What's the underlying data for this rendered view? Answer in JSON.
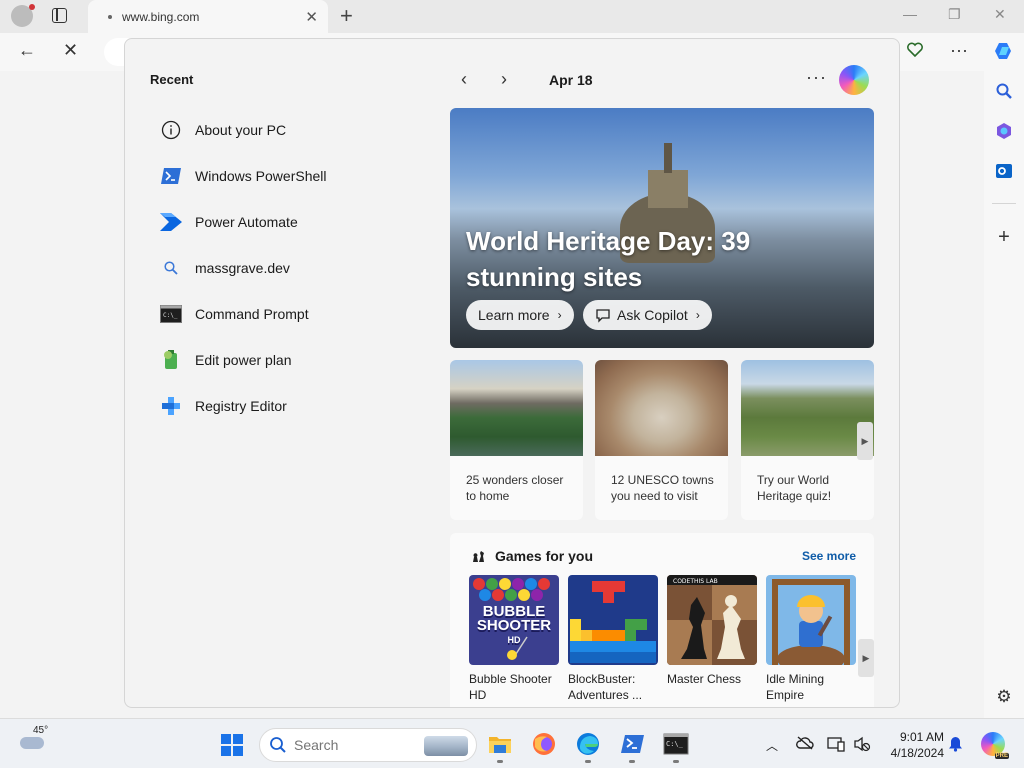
{
  "browser": {
    "tab_title": "www.bing.com",
    "tab_close_glyph": "✕",
    "new_tab_glyph": "+",
    "window_minimize_glyph": "—",
    "window_restore_glyph": "❐",
    "window_close_glyph": "✕",
    "back_glyph": "←",
    "stop_glyph": "✕",
    "more_glyph": "···",
    "add_glyph": "+",
    "settings_glyph": "⚙"
  },
  "start_panel": {
    "recent_title": "Recent",
    "recent_items": [
      {
        "label": "About your PC",
        "icon": "info-icon"
      },
      {
        "label": "Windows PowerShell",
        "icon": "powershell-icon"
      },
      {
        "label": "Power Automate",
        "icon": "power-automate-icon"
      },
      {
        "label": "massgrave.dev",
        "icon": "search-icon"
      },
      {
        "label": "Command Prompt",
        "icon": "command-prompt-icon"
      },
      {
        "label": "Edit power plan",
        "icon": "power-plan-icon"
      },
      {
        "label": "Registry Editor",
        "icon": "registry-editor-icon"
      }
    ],
    "prev_glyph": "‹",
    "next_glyph": "›",
    "date": "Apr 18",
    "more_glyph": "···",
    "hero": {
      "title": "World Heritage Day: 39 stunning sites",
      "learn_more": "Learn more",
      "ask_copilot": "Ask Copilot",
      "chevron": "›"
    },
    "cards": [
      {
        "caption": "25 wonders closer to home"
      },
      {
        "caption": "12 UNESCO towns you need to visit"
      },
      {
        "caption": "Try our World Heritage quiz!"
      }
    ],
    "scroll_glyph": "▶",
    "games": {
      "title": "Games for you",
      "see_more": "See more",
      "bubble_logo": "BUBBLE SHOOTER",
      "bubble_logo_sub": "HD",
      "chess_logo": "CODETHIS LAB",
      "items": [
        {
          "name": "Bubble Shooter HD"
        },
        {
          "name": "BlockBuster: Adventures ..."
        },
        {
          "name": "Master Chess"
        },
        {
          "name": "Idle Mining Empire"
        }
      ]
    }
  },
  "taskbar": {
    "weather_temp": "45°",
    "search_placeholder": "Search",
    "time": "9:01 AM",
    "date": "4/18/2024",
    "copilot_badge": "PRE",
    "chevron_glyph": "︿"
  },
  "colors": {
    "accent": "#0f5ca8",
    "windows_blue": "#1a73e8",
    "notification_red": "#d13438"
  }
}
